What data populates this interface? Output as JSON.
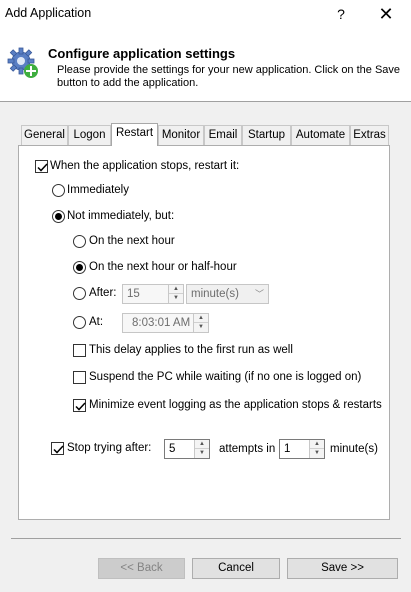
{
  "window": {
    "title": "Add Application",
    "help": "?",
    "close": "✕"
  },
  "header": {
    "title": "Configure application settings",
    "description": "Please provide the settings for your new application. Click on the Save button to add the application."
  },
  "tabs": [
    "General",
    "Logon",
    "Restart",
    "Monitor",
    "Email",
    "Startup",
    "Automate",
    "Extras"
  ],
  "active_tab": "Restart",
  "restart": {
    "restart_when_stops": {
      "label": "When the application stops, restart it:",
      "checked": true
    },
    "immediately": {
      "label": "Immediately",
      "selected": false
    },
    "not_immediately": {
      "label": "Not immediately, but:",
      "selected": true
    },
    "next_hour": {
      "label": "On the next hour",
      "selected": false
    },
    "next_hour_or_half": {
      "label": "On the next hour or half-hour",
      "selected": true
    },
    "after": {
      "label": "After:",
      "selected": false,
      "value": "15",
      "unit": "minute(s)"
    },
    "at": {
      "label": "At:",
      "selected": false,
      "value": "8:03:01 AM"
    },
    "delay_first_run": {
      "label": "This delay applies to the first run as well",
      "checked": false
    },
    "suspend_pc": {
      "label": "Suspend the PC while waiting (if no one is logged on)",
      "checked": false
    },
    "minimize_logging": {
      "label": "Minimize event logging as the application stops & restarts",
      "checked": true
    },
    "stop_trying": {
      "label": "Stop trying after:",
      "checked": true,
      "attempts": "5",
      "attempts_label": "attempts in",
      "minutes": "1",
      "minutes_label": "minute(s)"
    }
  },
  "buttons": {
    "back": "<< Back",
    "cancel": "Cancel",
    "save": "Save >>"
  },
  "icons": {
    "help": "help-icon",
    "close": "close-icon",
    "header": "gear-add-icon"
  },
  "colors": {
    "check_green": "#3fae3f",
    "gear_blue": "#5a7fc4"
  }
}
